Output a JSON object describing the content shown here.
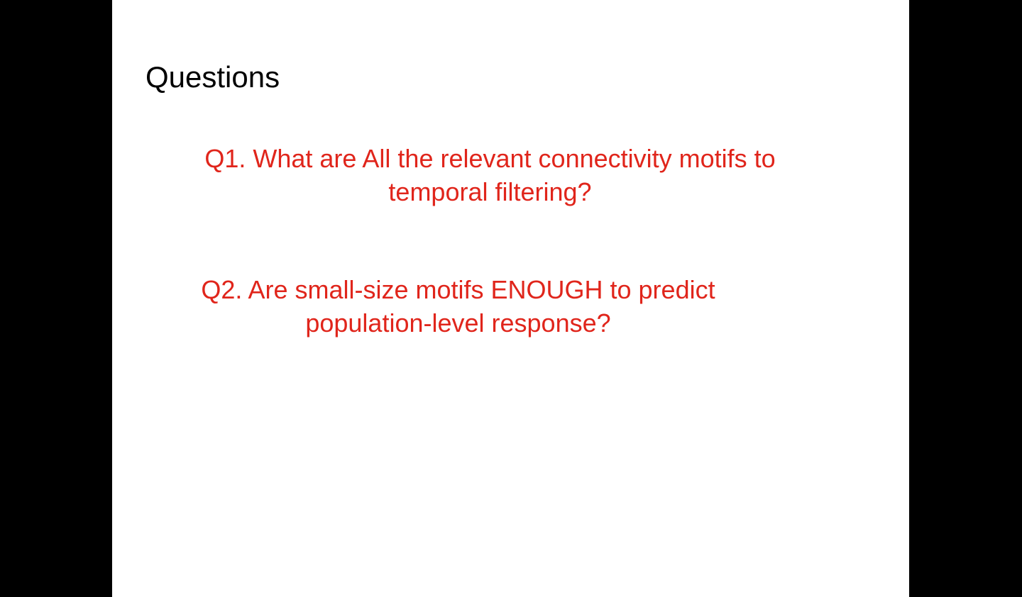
{
  "slide": {
    "title": "Questions",
    "questions": [
      {
        "lines": [
          "Q1. What are All the relevant connectivity motifs to",
          "temporal filtering?"
        ]
      },
      {
        "lines": [
          "Q2. Are small-size motifs ENOUGH to predict",
          "population-level response?"
        ]
      }
    ]
  },
  "colors": {
    "background": "#000000",
    "slide": "#ffffff",
    "title_text": "#000000",
    "question_text": "#e0251b"
  }
}
